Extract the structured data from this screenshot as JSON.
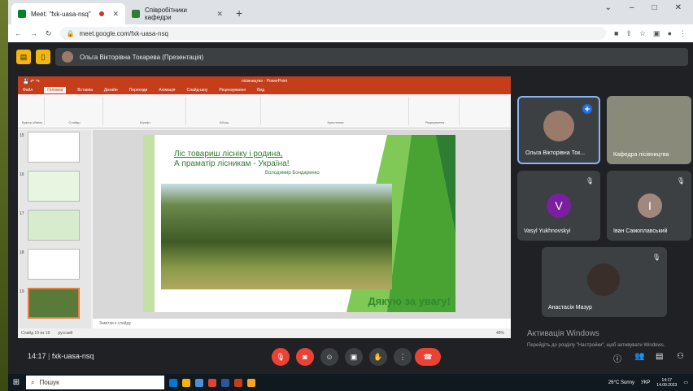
{
  "browser": {
    "tabs": [
      {
        "label": "Meet: \"fxk-uasa-nsq\"",
        "active": true
      },
      {
        "label": "Співробітники кафедри",
        "active": false
      }
    ],
    "url": "meet.google.com/fxk-uasa-nsq",
    "window_controls": [
      "⌄",
      "–",
      "□",
      "✕"
    ]
  },
  "meet": {
    "presenter_label": "Ольга Вікторівна Токарева (Презентація)",
    "time": "14:17",
    "meeting_code": "fxk-uasa-nsq",
    "participants": [
      {
        "name": "Ольга Вікторівна Ток...",
        "initial": "",
        "color": "#9a7b6a"
      },
      {
        "name": "Кафедра лісівництва",
        "initial": "",
        "color": "#8a8a7a"
      },
      {
        "name": "Vasyl Yukhnovskyi",
        "initial": "V",
        "color": "#7b1fa2"
      },
      {
        "name": "Іван Самоплавський",
        "initial": "І",
        "color": "#a1887f"
      },
      {
        "name": "Анастасія Мазур",
        "initial": "",
        "color": "#3a2e2a"
      }
    ],
    "activation_title": "Активація Windows",
    "activation_text": "Перейдіть до розділу \"Настройки\", щоб активувати Windows."
  },
  "powerpoint": {
    "title": "лісівництво - PowerPoint",
    "ribbon_tabs": [
      "Файл",
      "Головна",
      "Вставка",
      "Дизайн",
      "Переходи",
      "Анімація",
      "Слайд-шоу",
      "Рецензування",
      "Вид"
    ],
    "ribbon_groups": [
      "Буфер обміну",
      "Слайди",
      "Шрифт",
      "Абзац",
      "Креслення",
      "Редагування"
    ],
    "slide_numbers": [
      "15",
      "16",
      "17",
      "18",
      "19"
    ],
    "notes_placeholder": "Замітки к слайду",
    "status_left": "Слайд 19 из 19",
    "status_lang": "русский",
    "zoom": "48%",
    "slide": {
      "line1": "Ліс товариш лісніку і родина,",
      "line2": "А праматір лісникам - Україна!",
      "author": "Володимир Бондаренко",
      "thanks": "Дякую за увагу!"
    }
  },
  "taskbar": {
    "search_placeholder": "Пошук",
    "weather": "26°C Sunny",
    "lang": "УКР",
    "clock_time": "14:17",
    "clock_date": "14.09.2023"
  }
}
